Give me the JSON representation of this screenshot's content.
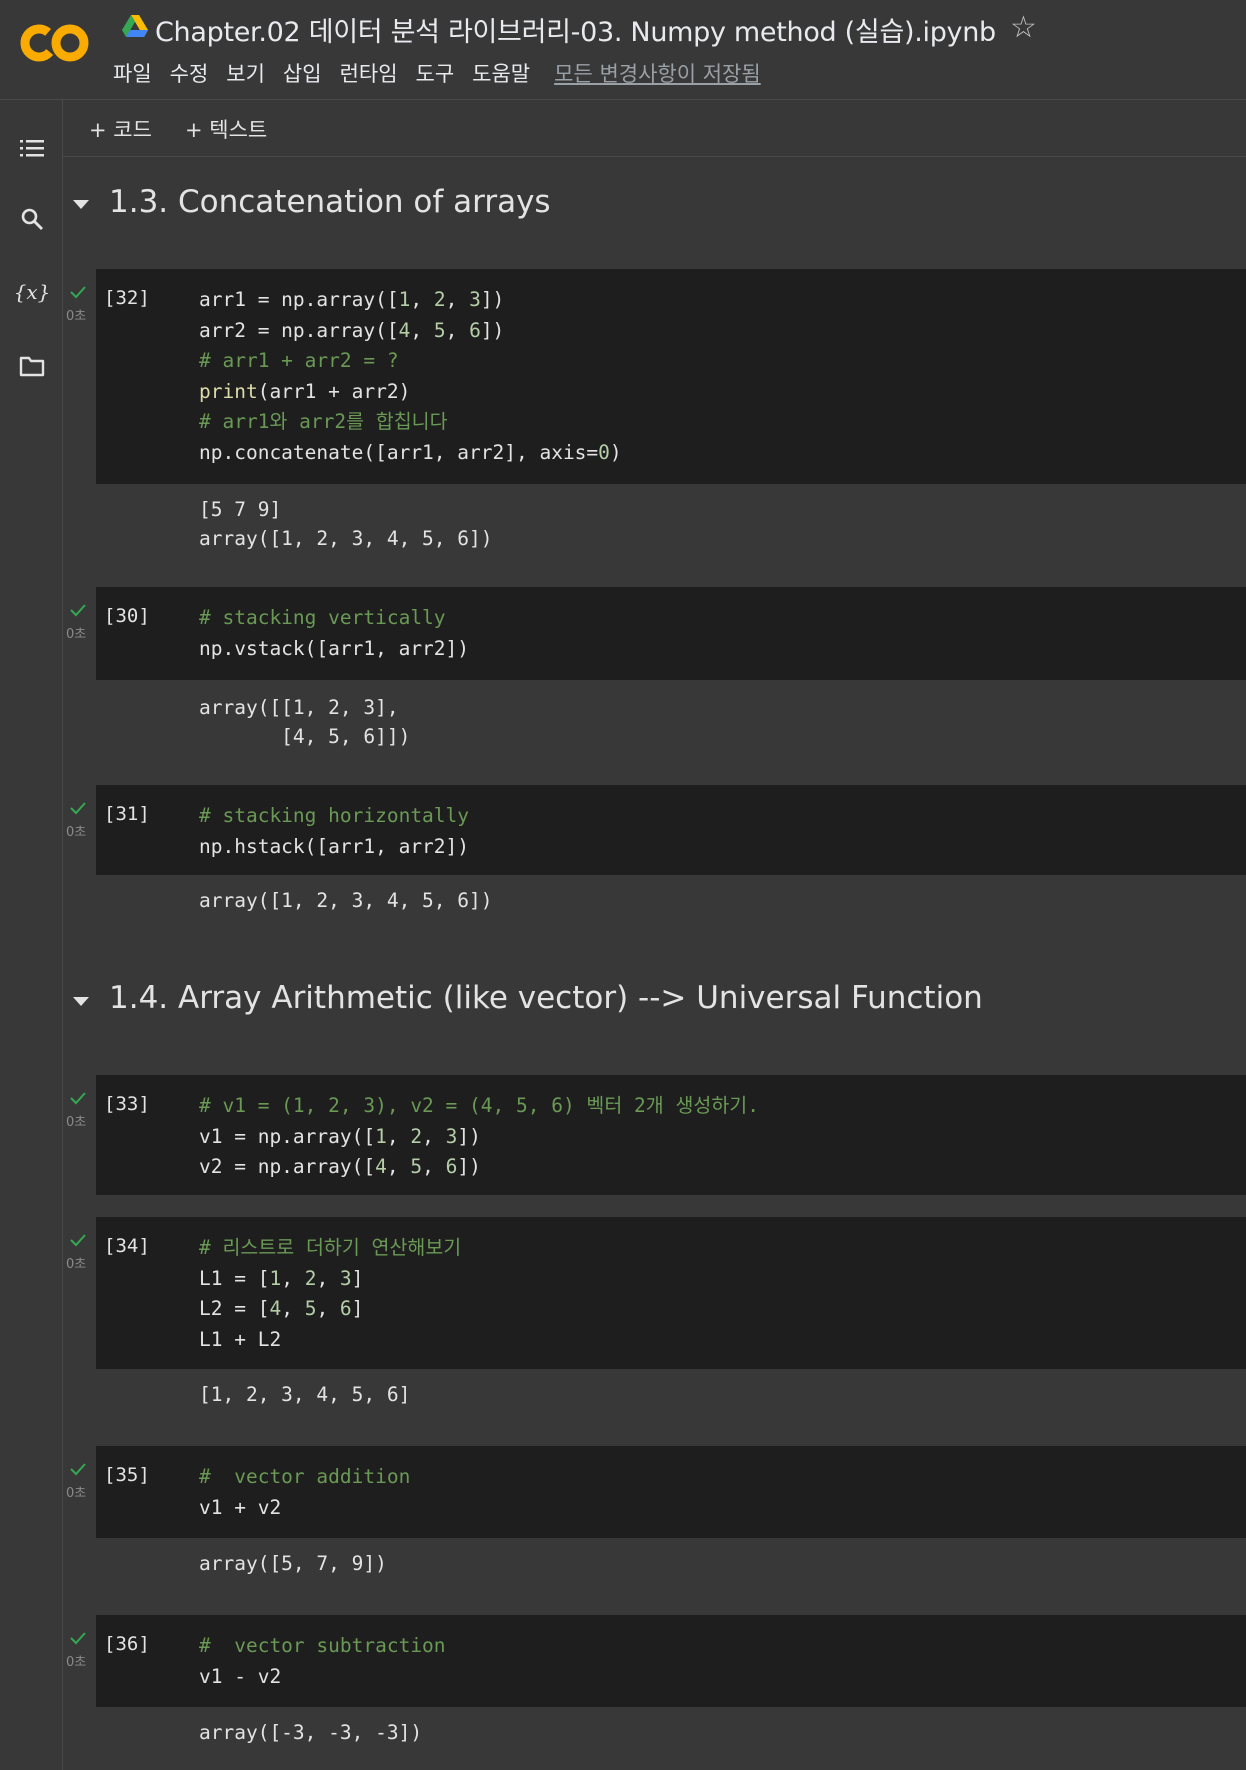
{
  "header": {
    "title": "Chapter.02 데이터 분석 라이브러리-03. Numpy method (실습).ipynb",
    "menu": [
      "파일",
      "수정",
      "보기",
      "삽입",
      "런타임",
      "도구",
      "도움말"
    ],
    "saved_status": "모든 변경사항이 저장됨"
  },
  "toolbar": {
    "add_code": "+ 코드",
    "add_text": "+ 텍스트"
  },
  "sections": {
    "s13": "1.3. Concatenation of arrays",
    "s14": "1.4. Array Arithmetic (like vector) --> Universal Function"
  },
  "exec_time": "0초",
  "cells": {
    "c32": {
      "count": "[32]",
      "code": [
        "arr1 = np.array([1, 2, 3])",
        "arr2 = np.array([4, 5, 6])",
        "# arr1 + arr2 = ?",
        "print(arr1 + arr2)",
        "# arr1와 arr2를 합칩니다",
        "np.concatenate([arr1, arr2], axis=0)"
      ],
      "output": [
        "[5 7 9]",
        "array([1, 2, 3, 4, 5, 6])"
      ]
    },
    "c30": {
      "count": "[30]",
      "code": [
        "# stacking vertically",
        "np.vstack([arr1, arr2])"
      ],
      "output": [
        "array([[1, 2, 3],",
        "       [4, 5, 6]])"
      ]
    },
    "c31": {
      "count": "[31]",
      "code": [
        "# stacking horizontally",
        "np.hstack([arr1, arr2])"
      ],
      "output": [
        "array([1, 2, 3, 4, 5, 6])"
      ]
    },
    "c33": {
      "count": "[33]",
      "code": [
        "# v1 = (1, 2, 3), v2 = (4, 5, 6) 벡터 2개 생성하기.",
        "v1 = np.array([1, 2, 3])",
        "v2 = np.array([4, 5, 6])"
      ],
      "output": []
    },
    "c34": {
      "count": "[34]",
      "code": [
        "# 리스트로 더하기 연산해보기",
        "L1 = [1, 2, 3]",
        "L2 = [4, 5, 6]",
        "L1 + L2"
      ],
      "output": [
        "[1, 2, 3, 4, 5, 6]"
      ]
    },
    "c35": {
      "count": "[35]",
      "code": [
        "#  vector addition",
        "v1 + v2"
      ],
      "output": [
        "array([5, 7, 9])"
      ]
    },
    "c36": {
      "count": "[36]",
      "code": [
        "#  vector subtraction",
        "v1 - v2"
      ],
      "output": [
        "array([-3, -3, -3])"
      ]
    }
  },
  "colors": {
    "background": "#383838",
    "code_bg": "#1e1e1e",
    "comment": "#6a9955",
    "number": "#b5cea8",
    "check": "#34a853"
  }
}
